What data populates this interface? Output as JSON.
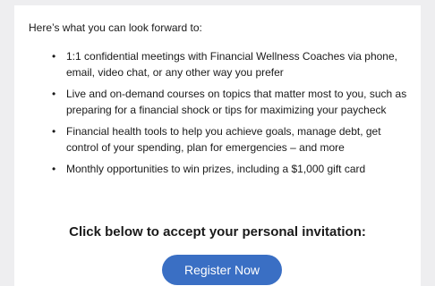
{
  "email": {
    "intro": "Here’s what you can look forward to:",
    "bullet_glyph": "•",
    "benefits": [
      "1:1 confidential meetings with Financial Wellness Coaches via phone, email, video chat, or any other way you prefer",
      "Live and on-demand courses on topics that matter most to you, such as preparing for a financial shock or tips for maximizing your paycheck",
      "Financial health tools to help you achieve goals, manage debt, get control of your spending, plan for emergencies – and more",
      "Monthly opportunities to win prizes, including a $1,000 gift card"
    ],
    "cta_heading": "Click below to accept your personal invitation:",
    "cta_button_label": "Register Now"
  },
  "colors": {
    "background": "#eeeef0",
    "card": "#ffffff",
    "text": "#1a1a1a",
    "button": "#3a6fc4",
    "button_text": "#ffffff"
  }
}
